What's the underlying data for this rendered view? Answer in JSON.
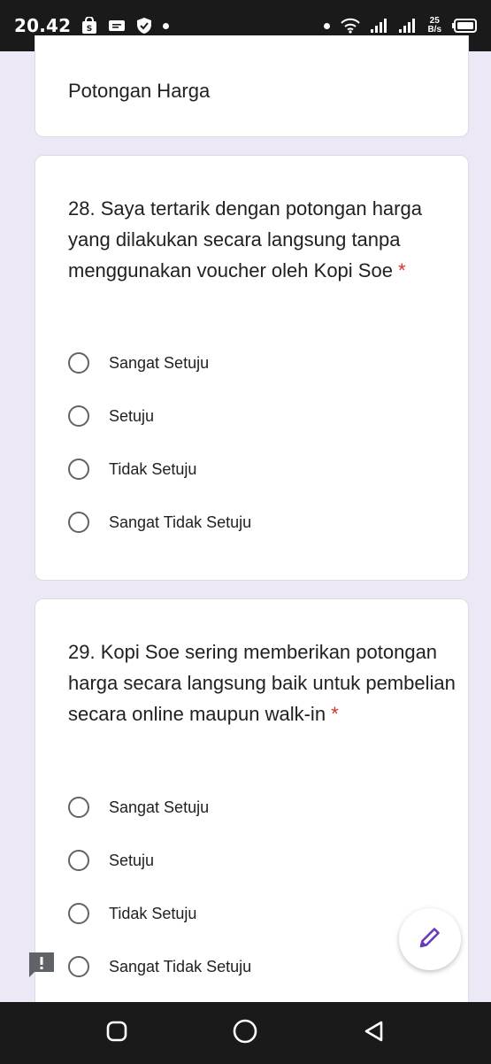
{
  "status_bar": {
    "time": "20.42",
    "speed_value": "25",
    "speed_unit": "B/s",
    "icons": [
      "shopee-bag-icon",
      "message-icon",
      "shield-check-icon",
      "notification-dot",
      "wifi-icon",
      "signal-icon",
      "signal-icon",
      "battery-icon"
    ]
  },
  "section_card": {
    "title": "Potongan Harga"
  },
  "questions": [
    {
      "text": "28. Saya tertarik dengan potongan harga yang dilakukan secara langsung tanpa menggunakan voucher oleh Kopi Soe",
      "required_mark": "*",
      "options": [
        "Sangat Setuju",
        "Setuju",
        "Tidak Setuju",
        "Sangat Tidak Setuju"
      ]
    },
    {
      "text": "29. Kopi Soe sering memberikan potongan harga secara langsung baik untuk pembelian secara online maupun walk-in",
      "required_mark": "*",
      "options": [
        "Sangat Setuju",
        "Setuju",
        "Tidak Setuju",
        "Sangat Tidak Setuju"
      ]
    }
  ],
  "colors": {
    "accent": "#673ab7",
    "background": "#ece8f5",
    "required": "#d93025"
  },
  "fab_icon": "pencil-edit-icon",
  "feedback_icon": "feedback-icon",
  "nav_icons": [
    "recent-apps-icon",
    "home-icon",
    "back-icon"
  ]
}
